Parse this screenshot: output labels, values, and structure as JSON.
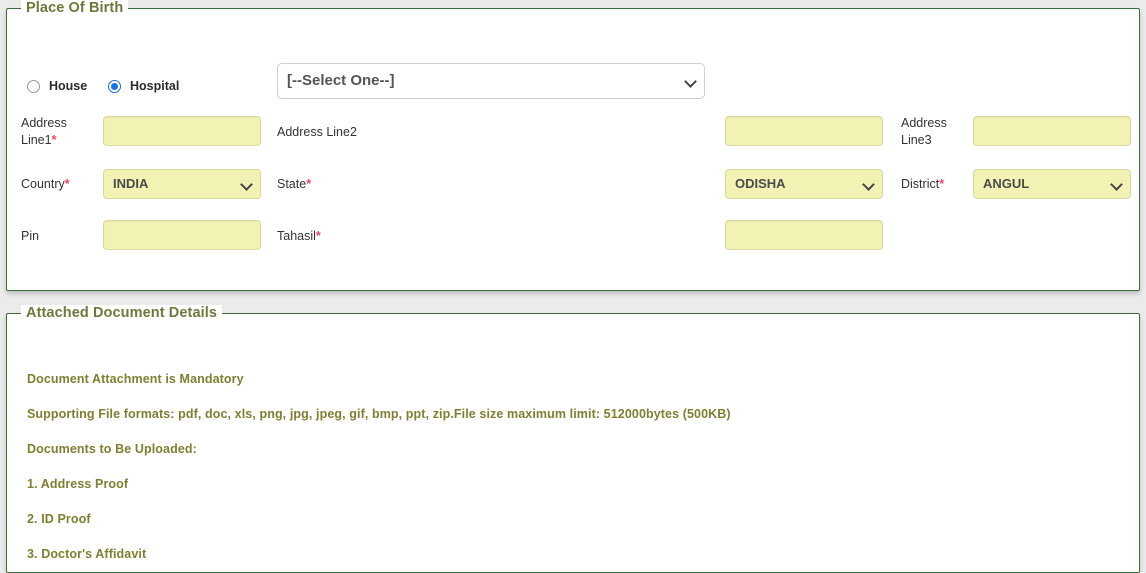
{
  "sections": {
    "birth": {
      "legend": "Place Of Birth",
      "radios": [
        {
          "label": "House",
          "selected": false
        },
        {
          "label": "Hospital",
          "selected": true
        }
      ],
      "hospital_select": {
        "value": "[--Select One--]",
        "options": [
          "[--Select One--]"
        ]
      },
      "fields": {
        "address_line1": {
          "label": "Address Line1",
          "required": true,
          "value": "",
          "placeholder": ""
        },
        "address_line2": {
          "label": "Address Line2",
          "required": false,
          "value": "",
          "placeholder": ""
        },
        "address_line3": {
          "label": "Address Line3",
          "required": false,
          "value": "",
          "placeholder": ""
        },
        "country": {
          "label": "Country",
          "required": true,
          "value": "INDIA",
          "options": [
            "INDIA"
          ]
        },
        "state": {
          "label": "State",
          "required": true,
          "value": "ODISHA",
          "options": [
            "ODISHA"
          ]
        },
        "district": {
          "label": "District",
          "required": true,
          "value": "ANGUL",
          "options": [
            "ANGUL"
          ]
        },
        "pin": {
          "label": "Pin",
          "required": false,
          "value": "",
          "placeholder": ""
        },
        "tahasil": {
          "label": "Tahasil",
          "required": true,
          "value": "",
          "placeholder": ""
        }
      }
    },
    "documents": {
      "legend": "Attached Document Details",
      "notes": [
        "Document Attachment is Mandatory",
        "Supporting File formats: pdf, doc, xls, png, jpg, jpeg, gif, bmp, ppt, zip.File size maximum limit: 512000bytes (500KB)",
        "Documents to Be Uploaded:",
        "1. Address Proof",
        "2. ID Proof",
        "3. Doctor's Affidavit"
      ]
    }
  },
  "colors": {
    "legend": "#6b7a3a",
    "panel_border": "#3c6e3c",
    "input_bg": "#f2f2b5",
    "required_asterisk": "#e8485f",
    "note_text": "#7f7f31",
    "radio_selected": "#1673e8",
    "page_bg": "#ebebeb"
  }
}
